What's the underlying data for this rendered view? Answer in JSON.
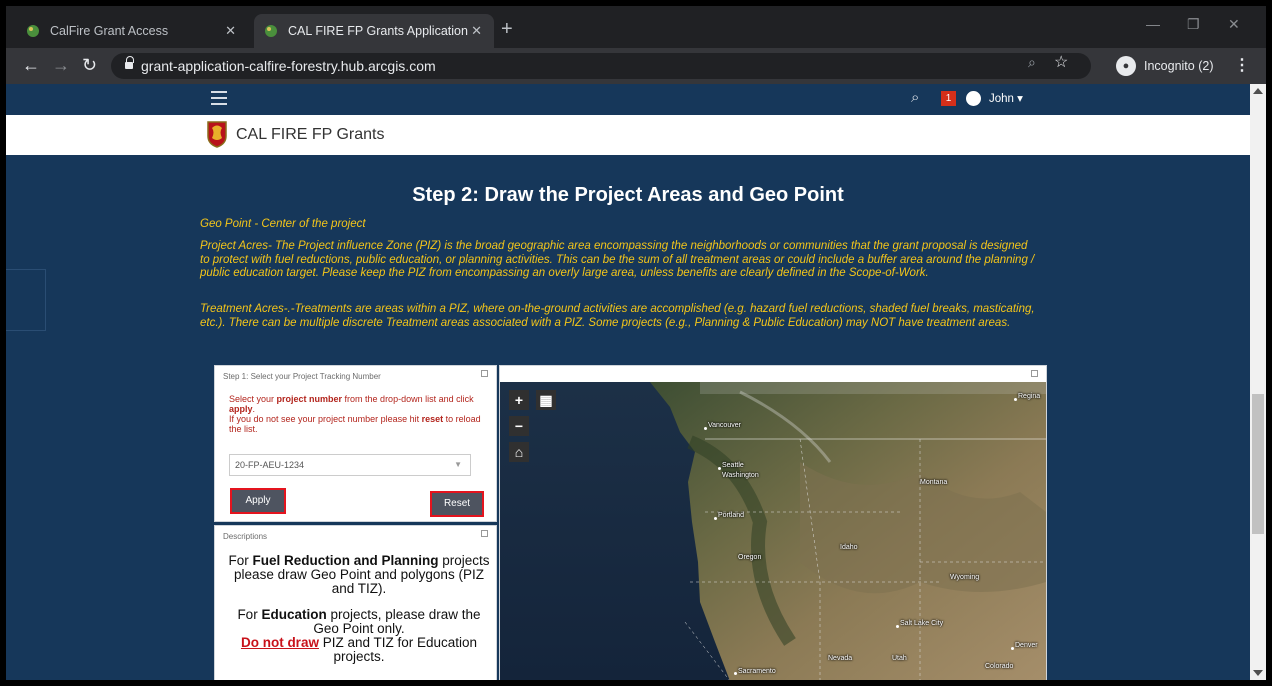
{
  "browser": {
    "tabs": [
      {
        "title": "CalFire Grant Access",
        "active": false
      },
      {
        "title": "CAL FIRE FP Grants Application",
        "active": true
      }
    ],
    "url": "grant-application-calfire-forestry.hub.arcgis.com",
    "incognito_label": "Incognito (2)"
  },
  "header": {
    "notification_count": "1",
    "user_name": "John ▾",
    "brand_name": "CAL FIRE FP Grants"
  },
  "page": {
    "title": "Step 2: Draw the Project Areas and Geo Point",
    "geo_point_note": "Geo Point - Center of the project",
    "project_acres_note": "Project Acres- The Project influence Zone (PIZ) is the broad geographic area encompassing the neighborhoods or communities that the grant proposal is designed to protect with fuel reductions, public education, or planning activities. This can be the sum of all treatment areas or could include a buffer area around the planning / public education target. Please keep the PIZ from encompassing an overly large area, unless benefits are clearly defined in the Scope-of-Work.",
    "treatment_acres_note": "Treatment Acres-.-Treatments are areas within a PIZ, where on-the-ground activities are accomplished (e.g. hazard fuel reductions, shaded fuel breaks, masticating, etc.). There can be multiple discrete Treatment areas associated with a PIZ. Some projects (e.g., Planning & Public Education) may NOT have treatment areas."
  },
  "step1_panel": {
    "header": "Step 1: Select your Project Tracking Number",
    "instr_1": "Select your ",
    "instr_bold_1": "project number",
    "instr_2": " from the drop-down list and click ",
    "instr_bold_2": "apply",
    "instr_3": ".",
    "instr_4": "If you do not see your project number please hit ",
    "instr_bold_3": "reset",
    "instr_5": " to reload the list.",
    "selected_project": "20-FP-AEU-1234",
    "apply_label": "Apply",
    "reset_label": "Reset"
  },
  "desc_panel": {
    "header": "Descriptions",
    "p1_a": "For ",
    "p1_bold": "Fuel Reduction and Planning",
    "p1_b": " projects please draw Geo Point and polygons (PIZ and TIZ).",
    "p2_a": "For ",
    "p2_bold": "Education",
    "p2_b": " projects, please draw the Geo Point only.",
    "p3_red": "Do not draw",
    "p3_b": " PIZ and TIZ for Education projects."
  },
  "map": {
    "labels": {
      "regina": "Regina",
      "vancouver": "Vancouver",
      "seattle": "Seattle",
      "washington": "Washington",
      "montana": "Montana",
      "portland": "Portland",
      "idaho": "Idaho",
      "oregon": "Oregon",
      "wyoming": "Wyoming",
      "salt_lake": "Salt Lake City",
      "denver": "Denver",
      "nevada": "Nevada",
      "utah": "Utah",
      "colorado": "Colorado",
      "sacramento": "Sacramento"
    }
  }
}
